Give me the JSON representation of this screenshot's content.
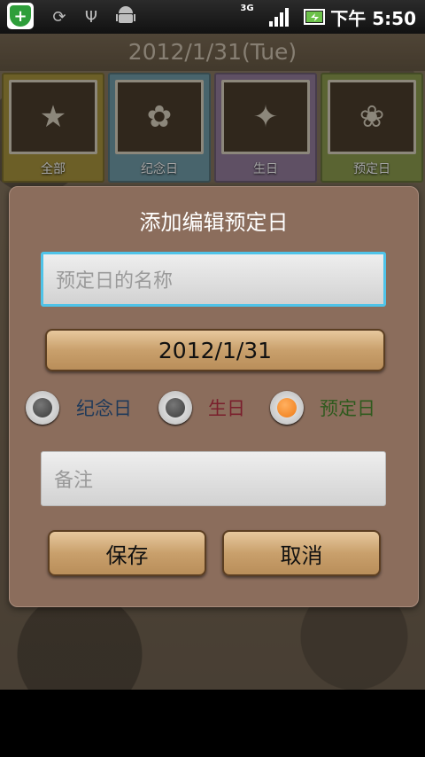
{
  "status_bar": {
    "icons": [
      "shield-icon",
      "sync-icon",
      "usb-icon",
      "android-icon",
      "signal-3g-icon",
      "signal-bars-icon",
      "battery-charging-icon"
    ],
    "network_label": "3G",
    "time": "下午 5:50"
  },
  "header": {
    "date": "2012/1/31(Tue)"
  },
  "categories": [
    {
      "label": "全部",
      "color": "#a6923c"
    },
    {
      "label": "纪念日",
      "color": "#6f9aa6"
    },
    {
      "label": "生日",
      "color": "#927c9a"
    },
    {
      "label": "预定日",
      "color": "#8a9a4e"
    }
  ],
  "dialog": {
    "title": "添加编辑预定日",
    "name_placeholder": "预定日的名称",
    "date_value": "2012/1/31",
    "radio_options": [
      {
        "label": "纪念日",
        "selected": false,
        "color": "#1f3a5a"
      },
      {
        "label": "生日",
        "selected": false,
        "color": "#7a1f2c"
      },
      {
        "label": "预定日",
        "selected": true,
        "color": "#2f5a1e"
      }
    ],
    "note_placeholder": "备注",
    "save_label": "保存",
    "cancel_label": "取消"
  }
}
